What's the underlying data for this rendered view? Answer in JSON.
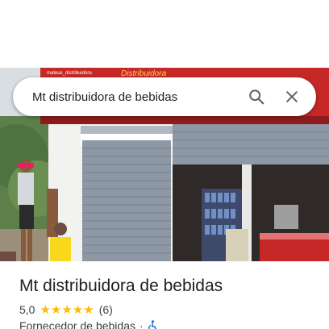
{
  "search": {
    "query": "Mt distribuidora de bebidas"
  },
  "photo": {
    "sign_text": "Distribuidora",
    "sign_small_text": "mateus_distribuidora"
  },
  "place": {
    "title": "Mt distribuidora de bebidas",
    "rating": "5,0",
    "stars": 5,
    "review_count": "(6)",
    "category": "Fornecedor de bebidas",
    "separator": "·"
  },
  "icons": {
    "search": "search-icon",
    "close": "close-icon",
    "accessibility": "wheelchair-icon",
    "star": "star-icon"
  },
  "colors": {
    "accent_google_blue": "#1a73e8",
    "star": "#fbbc04",
    "sign_red": "#c62828",
    "icon_gray": "#5f6368"
  }
}
